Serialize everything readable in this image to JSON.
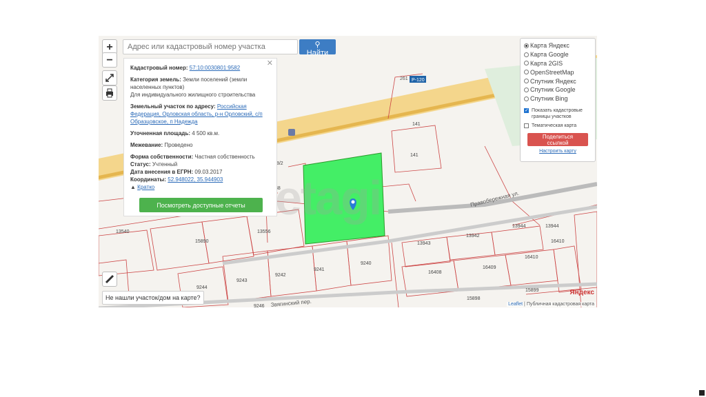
{
  "search": {
    "placeholder": "Адрес или кадастровый номер участка",
    "button": "Найти"
  },
  "controls": {
    "zoom_in": "+",
    "zoom_out": "−"
  },
  "info": {
    "cadastral_label": "Кадастровый номер:",
    "cadastral_number": "57:10:0030801:9582",
    "category_label": "Категория земель:",
    "category_value": "Земли поселений (земли населенных пунктов)",
    "usage": "Для индивидуального жилищного строительства",
    "address_label": "Земельный участок по адресу:",
    "address_value": "Российская Федерация, Орловская область, р-н Орловский, с/п Образцовское, п Надежда",
    "area_label": "Уточненная площадь:",
    "area_value": "4 500 кв.м.",
    "survey_label": "Межевание:",
    "survey_value": "Проведено",
    "ownership_label": "Форма собственности:",
    "ownership_value": "Частная собственность",
    "status_label": "Статус:",
    "status_value": "Учтенный",
    "egrn_label": "Дата внесения в ЕГРН:",
    "egrn_value": "09.03.2017",
    "coords_label": "Координаты:",
    "coords_value": "52.948022, 35.944903",
    "brief_link": "Кратко",
    "reports_button": "Посмотреть доступные отчеты"
  },
  "layers": {
    "options": [
      {
        "label": "Карта Яндекс",
        "selected": true
      },
      {
        "label": "Карта Google",
        "selected": false
      },
      {
        "label": "Карта 2GIS",
        "selected": false
      },
      {
        "label": "OpenStreetMap",
        "selected": false
      },
      {
        "label": "Спутник Яндекс",
        "selected": false
      },
      {
        "label": "Спутник Google",
        "selected": false
      },
      {
        "label": "Спутник Bing",
        "selected": false
      }
    ],
    "show_cadastral": "Показать кадастровые границы участков",
    "show_cadastral_checked": true,
    "thematic": "Тематическая карта",
    "thematic_checked": false,
    "share_button": "Поделиться ссылкой",
    "configure_link": "Настроить карту"
  },
  "map": {
    "road_label": "Р-120",
    "road_km": "261",
    "street_1": "Правобережная ул.",
    "street_2": "Звягинский пер.",
    "plot_numbers": [
      "141",
      "141",
      "13556",
      "13540",
      "15890",
      "13943",
      "13942",
      "13944",
      "16408",
      "16409",
      "16410",
      "15899",
      "15898",
      "9244",
      "9243",
      "9242",
      "9241",
      "9240",
      "9246",
      "/8/2",
      "38",
      "13944",
      "16410"
    ],
    "highlight_color": "#44ee66",
    "watermark": "etagi",
    "yandex_logo": "Яндекс"
  },
  "not_found": "Не нашли участок/дом на карте?",
  "attribution": {
    "leaflet": "Leaflet",
    "source": "Публичная кадастровая карта"
  }
}
